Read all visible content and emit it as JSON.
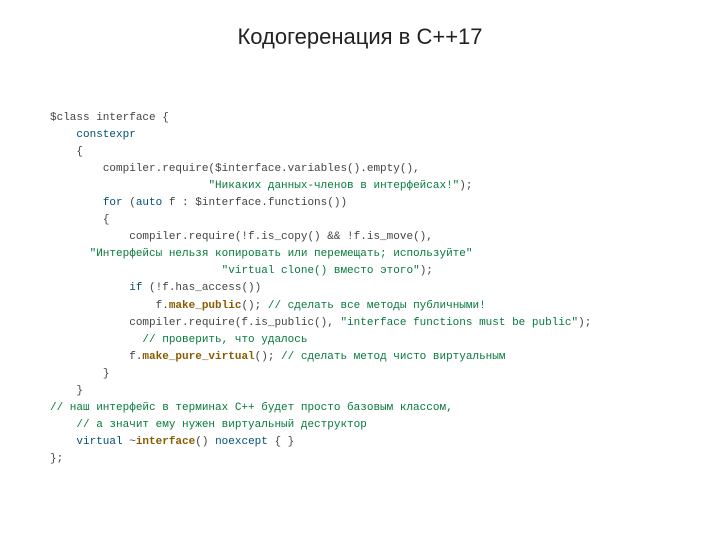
{
  "title": "Кодогеренация в С++17",
  "code": {
    "l01": "$class interface {",
    "l02_constexpr": "constexpr",
    "l03": "{",
    "l04": "compiler.require($interface.variables().empty(),",
    "l05_str": "\"Никаких данных-членов в интерфейсах!\"",
    "l05_tail": ");",
    "l06_for": "for",
    "l06_mid": " (",
    "l06_auto": "auto",
    "l06_tail": " f : $interface.functions())",
    "l07": "{",
    "l08": "compiler.require(!f.is_copy() && !f.is_move(),",
    "l09_str": "\"Интерфейсы нельзя копировать или перемещать; используйте\"",
    "l10_str": "\"virtual clone() вместо этого\"",
    "l10_tail": ");",
    "l11_if": "if",
    "l11_tail": " (!f.has_access())",
    "l12_pre": "f.",
    "l12_fn": "make_public",
    "l12_post": "(); ",
    "l12_cmt": "// сделать все методы публичными!",
    "l13_pre": "compiler.require(f.is_public(), ",
    "l13_str": "\"interface functions must be public\"",
    "l13_post": ");",
    "l14_cmt": "// проверить, что удалось",
    "l15_pre": "f.",
    "l15_fn": "make_pure_virtual",
    "l15_post": "(); ",
    "l15_cmt": "// сделать метод чисто виртуальным",
    "l16": "}",
    "l17": "}",
    "l18_cmt": "// наш интерфейс в терминах С++ будет просто базовым классом,",
    "l19_cmt": "// а значит ему нужен виртуальный деструктор",
    "l20_virtual": "virtual",
    "l20_mid": " ~",
    "l20_fn": "interface",
    "l20_post": "() ",
    "l20_noexcept": "noexcept",
    "l20_tail": " { }",
    "l21": "};"
  }
}
